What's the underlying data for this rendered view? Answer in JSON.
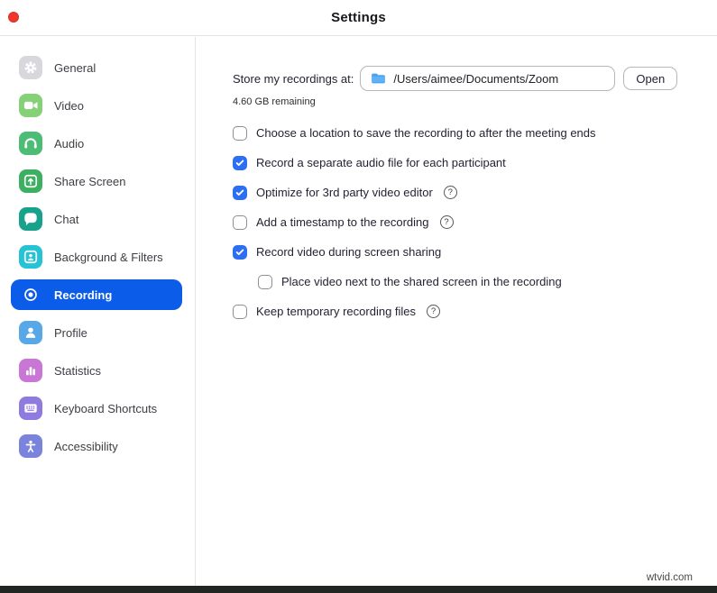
{
  "window": {
    "title": "Settings"
  },
  "colors": {
    "selected_blue": "#0b5ce8",
    "checkbox_blue": "#2e6ef3",
    "close_red": "#f0372c"
  },
  "icons": {
    "help_symbol": "?"
  },
  "sidebar": {
    "items": [
      {
        "label": "General",
        "icon": "gear-icon",
        "color": "#d8d8dc",
        "selected": false
      },
      {
        "label": "Video",
        "icon": "video-camera-icon",
        "color": "#86d077",
        "selected": false
      },
      {
        "label": "Audio",
        "icon": "headphones-icon",
        "color": "#4dbd76",
        "selected": false
      },
      {
        "label": "Share Screen",
        "icon": "share-screen-icon",
        "color": "#3cb060",
        "selected": false
      },
      {
        "label": "Chat",
        "icon": "chat-bubble-icon",
        "color": "#18a28c",
        "selected": false
      },
      {
        "label": "Background & Filters",
        "icon": "background-person-icon",
        "color": "#26c3d6",
        "selected": false
      },
      {
        "label": "Recording",
        "icon": "record-icon",
        "color": "",
        "selected": true
      },
      {
        "label": "Profile",
        "icon": "profile-person-icon",
        "color": "#58a8e8",
        "selected": false
      },
      {
        "label": "Statistics",
        "icon": "bar-chart-icon",
        "color": "#c877d5",
        "selected": false
      },
      {
        "label": "Keyboard Shortcuts",
        "icon": "keyboard-icon",
        "color": "#8f7adf",
        "selected": false
      },
      {
        "label": "Accessibility",
        "icon": "accessibility-icon",
        "color": "#7a84dc",
        "selected": false
      }
    ]
  },
  "main": {
    "storage": {
      "label": "Store my recordings at:",
      "path": "/Users/aimee/Documents/Zoom",
      "open_label": "Open",
      "remaining": "4.60 GB remaining"
    },
    "options": [
      {
        "label": "Choose a location to save the recording to after the meeting ends",
        "checked": false,
        "help": false,
        "indent": false
      },
      {
        "label": "Record a separate audio file for each participant",
        "checked": true,
        "help": false,
        "indent": false
      },
      {
        "label": "Optimize for 3rd party video editor",
        "checked": true,
        "help": true,
        "indent": false
      },
      {
        "label": "Add a timestamp to the recording",
        "checked": false,
        "help": true,
        "indent": false
      },
      {
        "label": "Record video during screen sharing",
        "checked": true,
        "help": false,
        "indent": false
      },
      {
        "label": "Place video next to the shared screen in the recording",
        "checked": false,
        "help": false,
        "indent": true
      },
      {
        "label": "Keep temporary recording files",
        "checked": false,
        "help": true,
        "indent": false
      }
    ]
  },
  "watermark": "wtvid.com"
}
